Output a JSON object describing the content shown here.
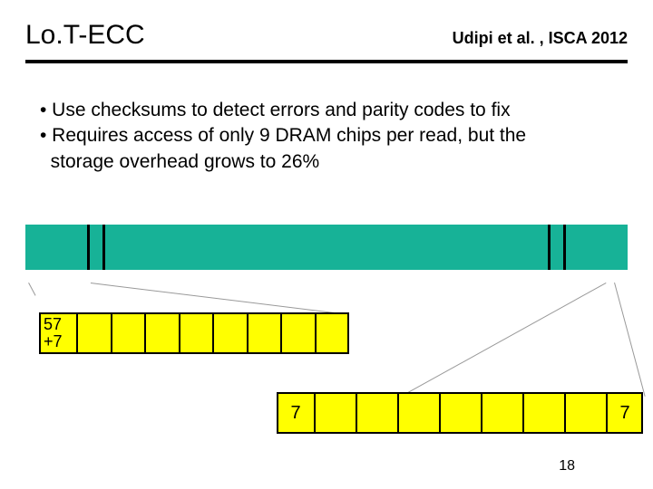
{
  "header": {
    "title": "Lo.T-ECC",
    "citation": "Udipi et al. , ISCA 2012"
  },
  "bullets": {
    "b1": "• Use checksums to detect errors and parity codes to fix",
    "b2": "• Requires access of only 9 DRAM chips per read, but the",
    "b2cont": "  storage overhead grows to 26%"
  },
  "labels": {
    "chip_data": "57",
    "chip_ecc": "+7",
    "seven_a": "7",
    "seven_b": "7"
  },
  "page": "18"
}
